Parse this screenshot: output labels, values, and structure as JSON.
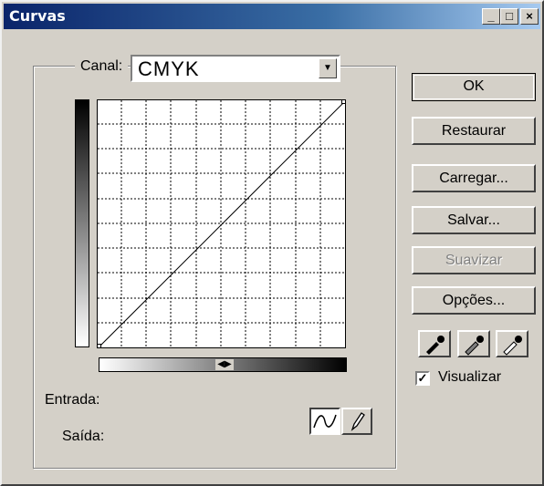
{
  "window": {
    "title": "Curvas",
    "minimize_glyph": "_",
    "maximize_glyph": "□",
    "close_glyph": "×"
  },
  "channel": {
    "label": "Canal:",
    "value": "CMYK",
    "dropdown_glyph": "▼"
  },
  "readouts": {
    "input_label": "Entrada:",
    "output_label": "Saída:"
  },
  "gradient": {
    "toggle_glyph": "◀▶"
  },
  "buttons": {
    "ok": "OK",
    "reset": "Restaurar",
    "load": "Carregar...",
    "save": "Salvar...",
    "smooth": "Suavizar",
    "options": "Opções..."
  },
  "preview": {
    "label": "Visualizar",
    "checked": true,
    "check_glyph": "✓"
  },
  "tools": {
    "curve_icon": "curve-tool-icon",
    "pencil_icon": "pencil-tool-icon"
  },
  "eyedroppers": [
    "black-eyedropper-icon",
    "gray-eyedropper-icon",
    "white-eyedropper-icon"
  ],
  "colors": {
    "titlebar_start": "#0a246a",
    "titlebar_end": "#a6caf0",
    "face": "#d4d0c8"
  }
}
